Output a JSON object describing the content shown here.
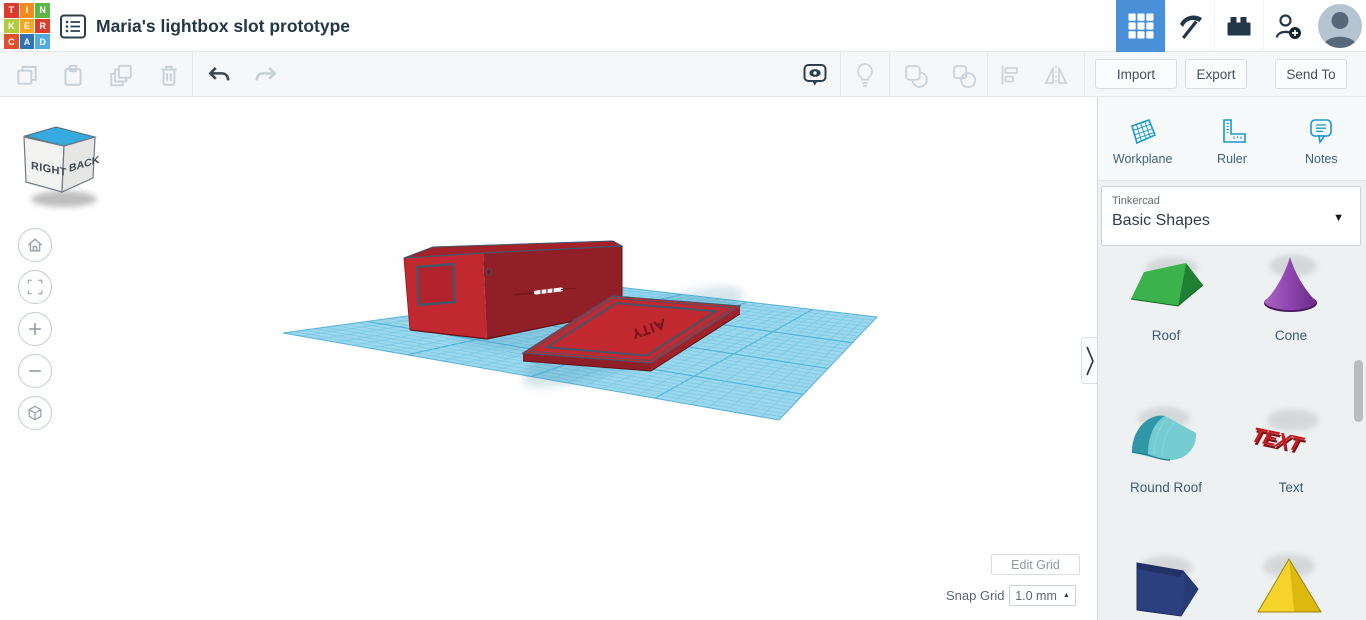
{
  "colors": {
    "header_accent_blue": "#4a90d9",
    "panel_icon_blue": "#1b96d1",
    "workplane_blue": "#9bd7ed",
    "workplane_line": "#73c6e3",
    "workplane_major_line": "#4fb0d8",
    "model_red_bright": "#c2282f",
    "model_red_dark": "#911f27",
    "outline_slate": "#44566a",
    "roof_green": "#3cb24c",
    "cone_purple": "#8e44ad",
    "round_roof_teal": "#72cbd2",
    "text_red": "#c41a20",
    "polygon_blue": "#2c4080",
    "pyramid_yellow": "#f6d32a"
  },
  "header": {
    "logo_letters": [
      "T",
      "I",
      "N",
      "K",
      "E",
      "R",
      "C",
      "A",
      "D"
    ],
    "title": "Maria's lightbox slot prototype",
    "right_icons": [
      "dashboard-grid",
      "minecraft-pickaxe",
      "brick",
      "invite-person",
      "avatar"
    ]
  },
  "toolbar": {
    "left_icons": [
      "copy",
      "paste",
      "duplicate",
      "delete",
      "undo",
      "redo"
    ],
    "right_icons": [
      "show-notes",
      "lightbulb",
      "group",
      "ungroup",
      "align",
      "mirror"
    ],
    "import_label": "Import",
    "export_label": "Export",
    "send_to_label": "Send To"
  },
  "viewcube": {
    "left_face": "RIGHT",
    "right_face": "BACK"
  },
  "nav": {
    "items": [
      "home-view",
      "fit-view",
      "zoom-in",
      "zoom-out",
      "perspective-toggle"
    ]
  },
  "canvas": {
    "edit_grid_label": "Edit Grid",
    "snap_grid_label": "Snap Grid",
    "snap_grid_value": "1.0 mm"
  },
  "right_panel": {
    "tools": [
      {
        "label": "Workplane"
      },
      {
        "label": "Ruler"
      },
      {
        "label": "Notes"
      }
    ],
    "library_vendor": "Tinkercad",
    "library_name": "Basic Shapes",
    "shapes": [
      {
        "label": "Roof"
      },
      {
        "label": "Cone"
      },
      {
        "label": "Round Roof"
      },
      {
        "label": "Text",
        "icon_text": "TEXT"
      },
      {
        "label": ""
      },
      {
        "label": ""
      }
    ]
  }
}
